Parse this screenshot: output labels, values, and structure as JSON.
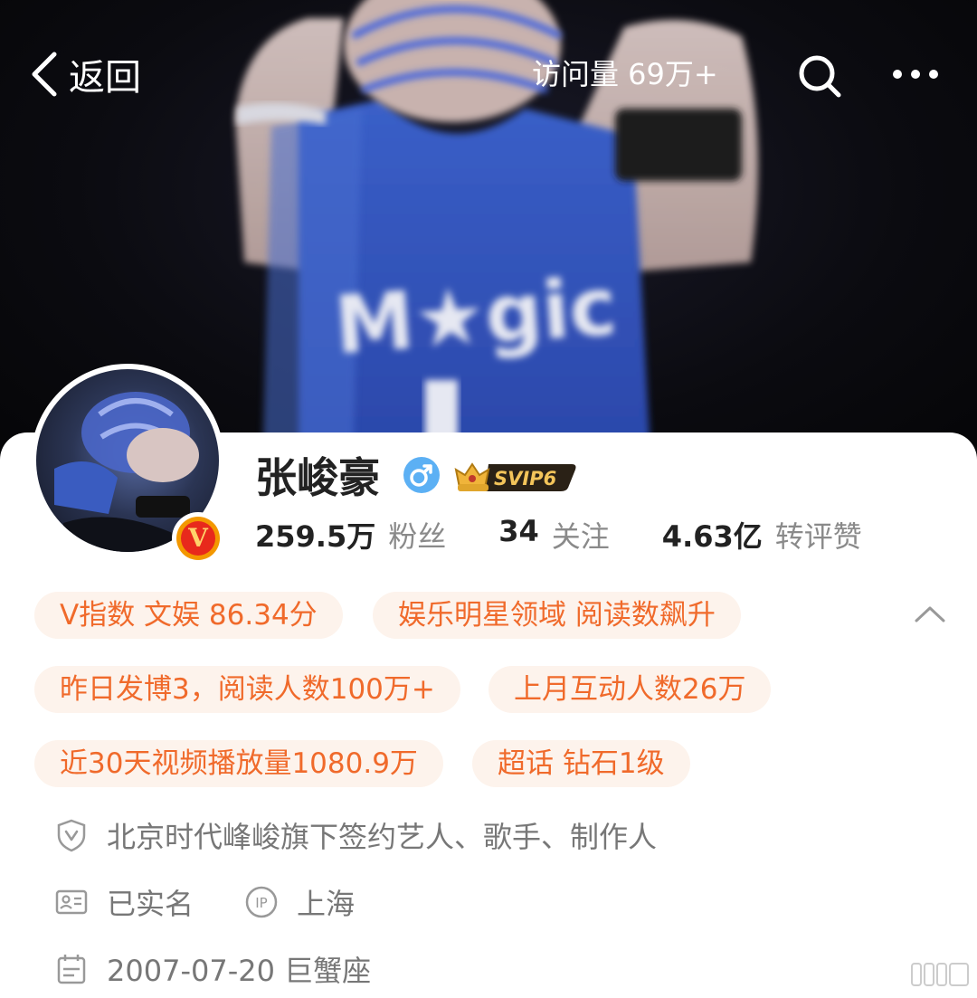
{
  "nav": {
    "back_label": "返回",
    "visits": "访问量 69万+"
  },
  "cover": {
    "jersey_text": "Magic"
  },
  "profile": {
    "name": "张峻豪",
    "gender_symbol": "♂",
    "svip_label": "SVIP6",
    "verified_symbol": "V",
    "stats": [
      {
        "num": "259.5万",
        "label": "粉丝"
      },
      {
        "num": "34",
        "label": "关注"
      },
      {
        "num": "4.63亿",
        "label": "转评赞"
      }
    ]
  },
  "chips": [
    "V指数 文娱 86.34分",
    "娱乐明星领域 阅读数飙升",
    "昨日发博3，阅读人数100万+",
    "上月互动人数26万",
    "近30天视频播放量1080.9万",
    "超话 钻石1级"
  ],
  "info": {
    "verification": "北京时代峰峻旗下签约艺人、歌手、制作人",
    "realname": "已实名",
    "ip_label": "IP",
    "ip_location": "上海",
    "birthday": "2007-07-20 巨蟹座"
  },
  "colors": {
    "chip_bg": "#fdf3ec",
    "chip_text": "#f06a2b",
    "gender_blue": "#5cb0f4",
    "svip_gold": "#e0a52c"
  }
}
